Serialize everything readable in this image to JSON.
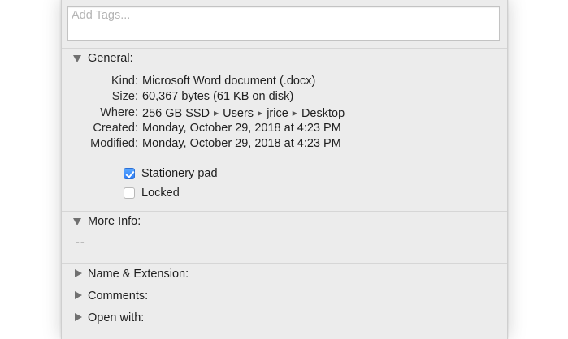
{
  "tags": {
    "placeholder": "Add Tags..."
  },
  "general": {
    "header": "General:",
    "rows": [
      {
        "label": "Kind:",
        "value": "Microsoft Word document (.docx)"
      },
      {
        "label": "Size:",
        "value": "60,367 bytes (61 KB on disk)"
      },
      {
        "label": "Where:",
        "path": [
          "256 GB SSD",
          "Users",
          "jrice",
          "Desktop"
        ]
      },
      {
        "label": "Created:",
        "value": "Monday, October 29, 2018 at 4:23 PM"
      },
      {
        "label": "Modified:",
        "value": "Monday, October 29, 2018 at 4:23 PM"
      }
    ],
    "path_separator": "▶",
    "checkboxes": [
      {
        "label": "Stationery pad",
        "checked": true
      },
      {
        "label": "Locked",
        "checked": false
      }
    ]
  },
  "more_info": {
    "header": "More Info:",
    "value": "--"
  },
  "sections": [
    {
      "label": "Name & Extension:",
      "expanded": false
    },
    {
      "label": "Comments:",
      "expanded": false
    },
    {
      "label": "Open with:",
      "expanded": false
    }
  ]
}
